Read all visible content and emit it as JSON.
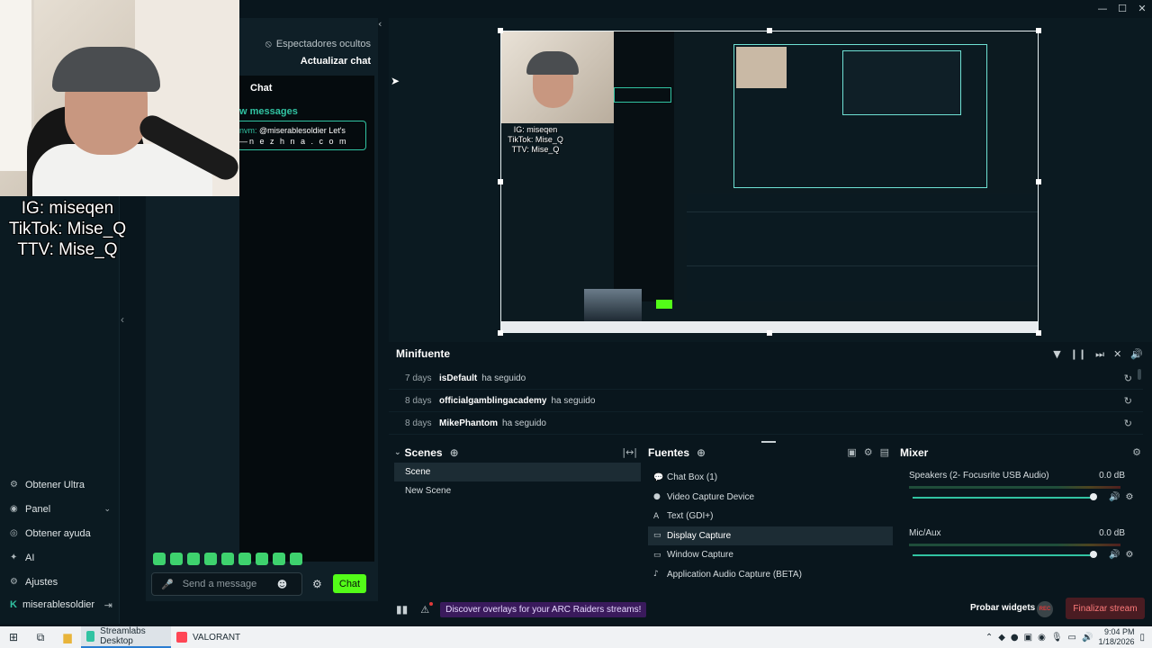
{
  "window": {
    "minimize": "—",
    "maximize": "☐",
    "close": "✕"
  },
  "overlay": {
    "line1": "IG: miseqen",
    "line2": "TikTok: Mise_Q",
    "line3": "TTV: Mise_Q"
  },
  "nav": {
    "items": [
      {
        "icon": "ultra-icon",
        "glyph": "⚙",
        "label": "Obtener Ultra"
      },
      {
        "icon": "panel-icon",
        "glyph": "◉",
        "label": "Panel",
        "chevron": "⌄"
      },
      {
        "icon": "help-icon",
        "glyph": "◎",
        "label": "Obtener ayuda"
      },
      {
        "icon": "ai-icon",
        "glyph": "✦",
        "label": "AI"
      },
      {
        "icon": "settings-icon",
        "glyph": "⚙",
        "label": "Ajustes"
      }
    ],
    "user": {
      "label": "miserablesoldier",
      "logout": "⇥"
    }
  },
  "chat": {
    "hidden_viewers": "Espectadores ocultos",
    "refresh": "Actualizar chat",
    "title": "Chat",
    "new_messages": "w messages",
    "message_user": "nvm:",
    "message_text": "@miserablesoldier Let's",
    "message_tail": "—n e z h n a . c o m",
    "input_placeholder": "Send a message",
    "send_label": "Chat"
  },
  "minifeed": {
    "title": "Minifuente",
    "events": [
      {
        "age": "7 days",
        "user": "isDefault",
        "action": "ha seguido"
      },
      {
        "age": "8 days",
        "user": "officialgamblingacademy",
        "action": "ha seguido"
      },
      {
        "age": "8 days",
        "user": "MikePhantom",
        "action": "ha seguido"
      }
    ]
  },
  "scenes": {
    "title": "Scenes",
    "items": [
      "Scene",
      "New Scene"
    ]
  },
  "sources": {
    "title": "Fuentes",
    "items": [
      {
        "icon": "chat-icon",
        "glyph": "💬",
        "label": "Chat Box (1)"
      },
      {
        "icon": "camera-icon",
        "glyph": "●",
        "label": "Video Capture Device"
      },
      {
        "icon": "text-icon",
        "glyph": "A",
        "label": "Text (GDI+)"
      },
      {
        "icon": "monitor-icon",
        "glyph": "▭",
        "label": "Display Capture"
      },
      {
        "icon": "window-icon",
        "glyph": "▭",
        "label": "Window Capture"
      },
      {
        "icon": "audio-icon",
        "glyph": "♪",
        "label": "Application Audio Capture (BETA)"
      }
    ]
  },
  "mixer": {
    "title": "Mixer",
    "channels": [
      {
        "name": "Speakers (2- Focusrite USB Audio)",
        "db": "0.0 dB",
        "level": 1.0
      },
      {
        "name": "Mic/Aux",
        "db": "0.0 dB",
        "level": 1.0
      }
    ]
  },
  "footer": {
    "promo": "Discover overlays for your ARC Raiders streams!",
    "try_widgets": "Probar widgets",
    "rec": "REC",
    "end_stream": "Finalizar stream"
  },
  "taskbar": {
    "apps": [
      {
        "label": "Streamlabs Desktop",
        "color": "#31c3a2"
      },
      {
        "label": "VALORANT",
        "color": "#ff4655"
      }
    ],
    "time": "9:04 PM",
    "date": "1/18/2026"
  }
}
